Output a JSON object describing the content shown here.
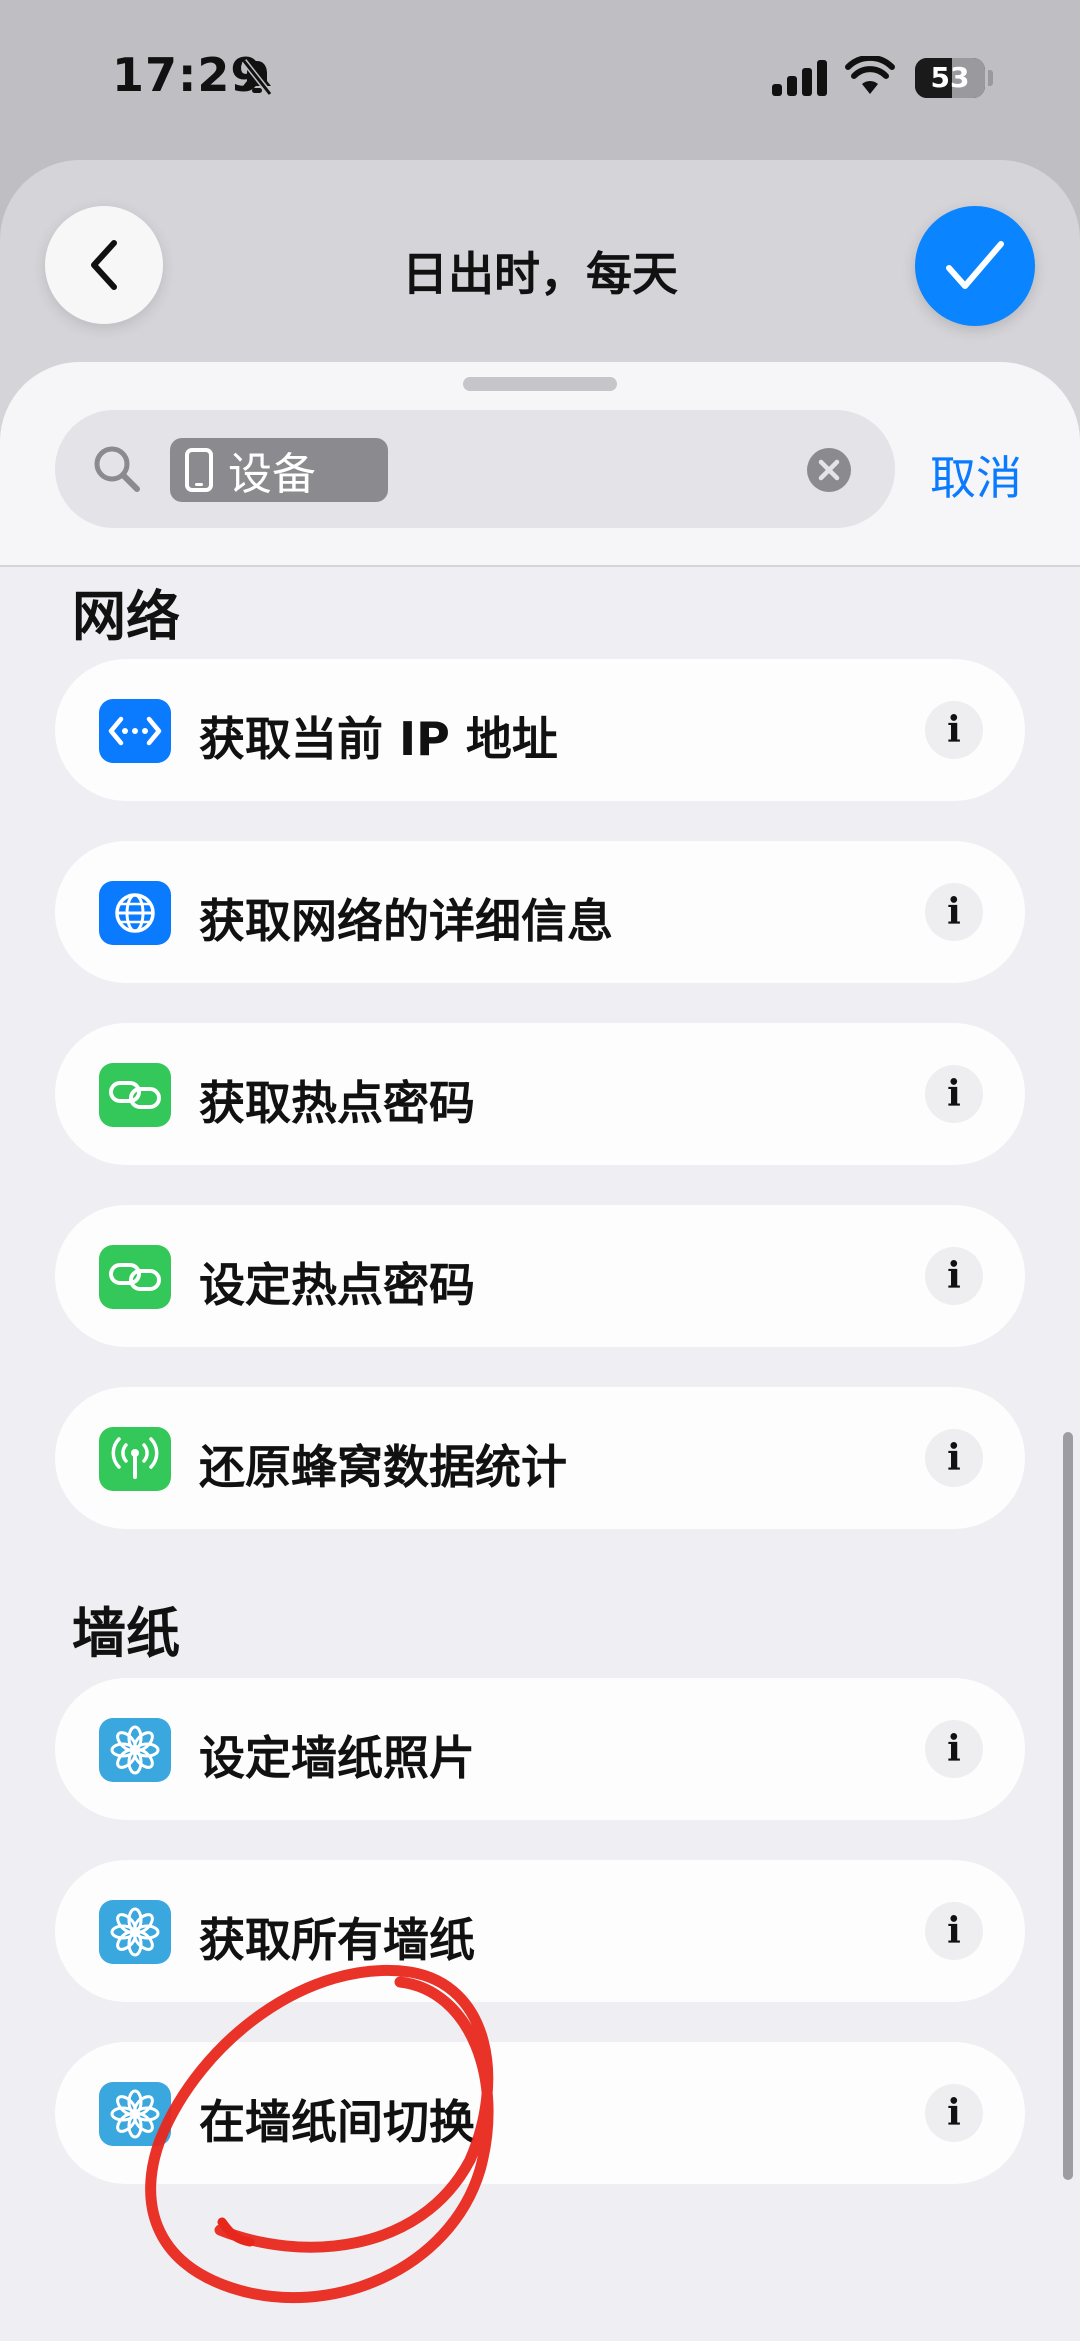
{
  "status_bar": {
    "time": "17:29",
    "battery": "53",
    "battery_level": 0.53
  },
  "header": {
    "title": "日出时，每天"
  },
  "search": {
    "token": "设备",
    "cancel": "取消"
  },
  "sections": [
    {
      "title": "网络",
      "items": [
        {
          "label": "获取当前 IP 地址",
          "icon": "ip-address-icon",
          "color": "#0a7aff"
        },
        {
          "label": "获取网络的详细信息",
          "icon": "globe-icon",
          "color": "#0a7aff"
        },
        {
          "label": "获取热点密码",
          "icon": "hotspot-link-icon",
          "color": "#34c759"
        },
        {
          "label": "设定热点密码",
          "icon": "hotspot-link-icon",
          "color": "#34c759"
        },
        {
          "label": "还原蜂窝数据统计",
          "icon": "antenna-icon",
          "color": "#34c759"
        }
      ]
    },
    {
      "title": "墙纸",
      "items": [
        {
          "label": "设定墙纸照片",
          "icon": "flower-icon",
          "color": "#3aa8de"
        },
        {
          "label": "获取所有墙纸",
          "icon": "flower-icon",
          "color": "#3aa8de"
        },
        {
          "label": "在墙纸间切换",
          "icon": "flower-icon",
          "color": "#3aa8de"
        }
      ]
    }
  ],
  "info_glyph": "i",
  "colors": {
    "accent": "#0a7aff",
    "annotation": "#e8271c"
  }
}
